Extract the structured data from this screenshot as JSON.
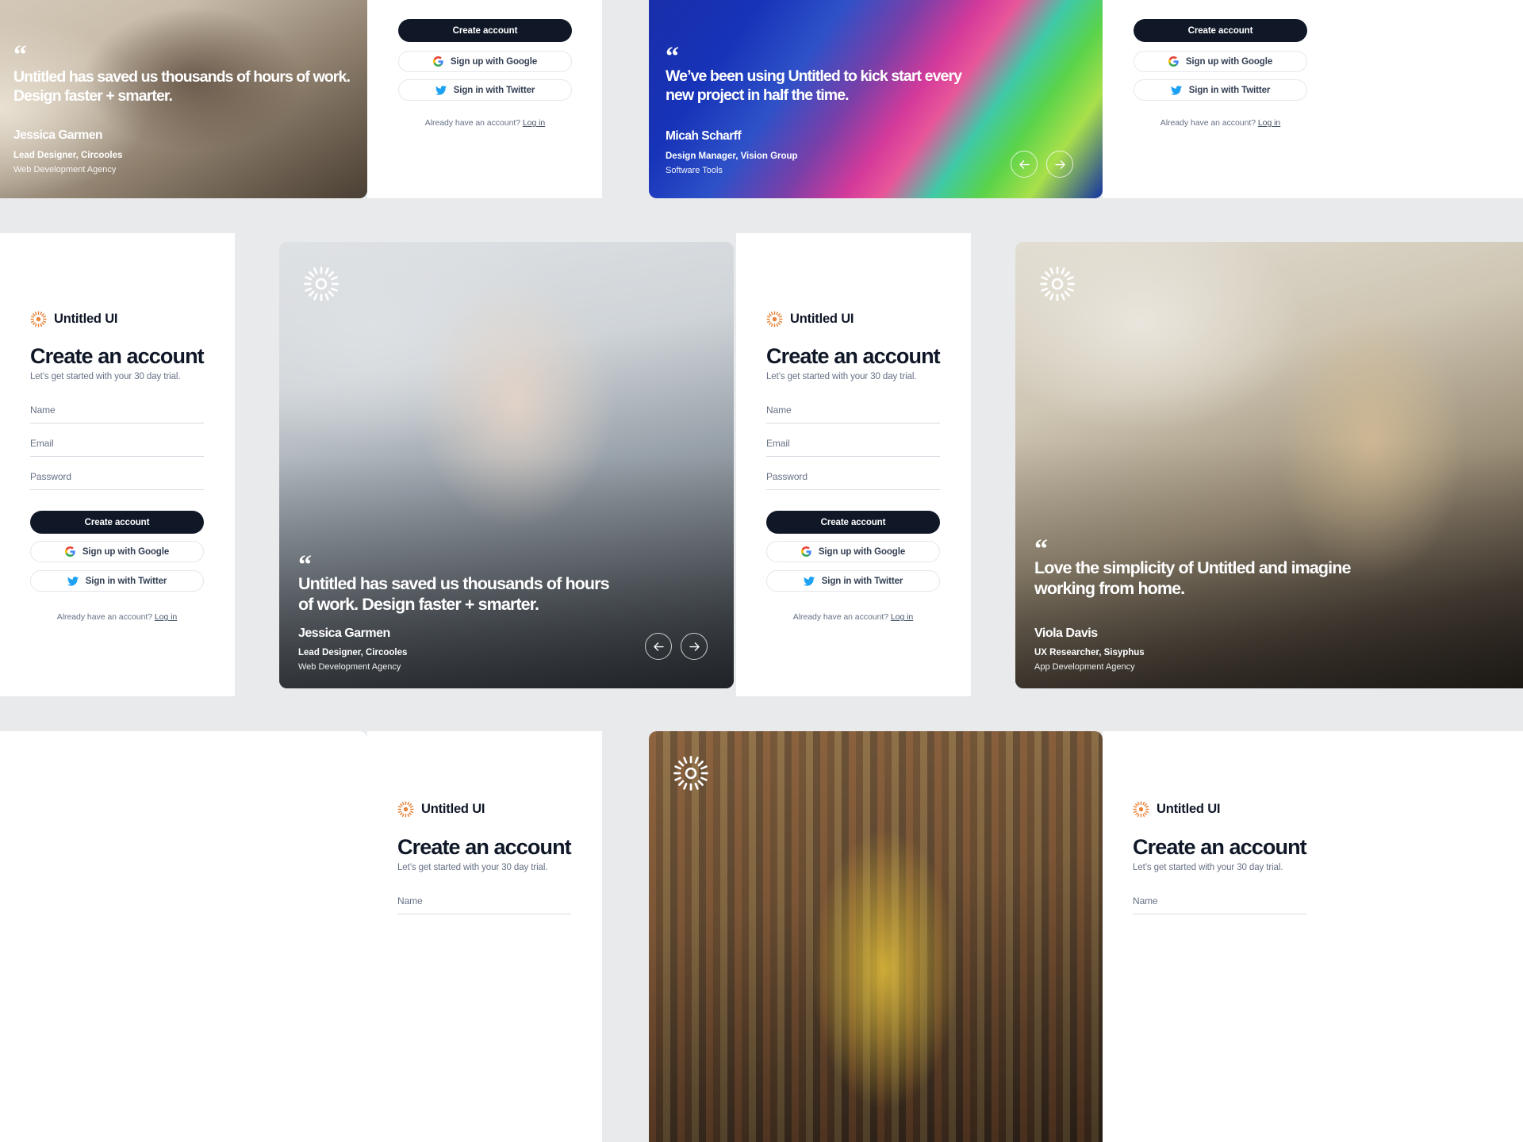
{
  "brand": {
    "name": "Untitled UI",
    "logo_icon": "sun-burst-logo-icon",
    "accent_color": "#E8833A"
  },
  "signup": {
    "title": "Create an account",
    "subtitle": "Let’s get started with your 30 day trial.",
    "fields": [
      {
        "label": "Name",
        "value": "",
        "name": "name-field"
      },
      {
        "label": "Email",
        "value": "",
        "name": "email-field"
      },
      {
        "label": "Password",
        "value": "",
        "name": "password-field"
      }
    ],
    "primary_button": "Create account",
    "google_button": "Sign up with Google",
    "twitter_button": "Sign in with Twitter",
    "footnote_text": "Already have an account?",
    "footnote_link": "Log in"
  },
  "testimonials": {
    "jessica": {
      "quote": "Untitled has saved us thousands of hours of work. Design faster + smarter.",
      "name": "Jessica Garmen",
      "role": "Lead Designer, Circooles",
      "company": "Web Development Agency"
    },
    "micah": {
      "quote": "We’ve been using Untitled to kick start every new project in half the time.",
      "name": "Micah Scharff",
      "role": "Design Manager, Vision Group",
      "company": "Software Tools"
    },
    "viola": {
      "quote": "Love the simplicity of Untitled and imagine working from home.",
      "name": "Viola Davis",
      "role": "UX Researcher, Sisyphus",
      "company": "App Development Agency"
    }
  },
  "carousel": {
    "prev_icon": "arrow-left-icon",
    "next_icon": "arrow-right-icon"
  },
  "colors": {
    "page_background": "#E8EAEC",
    "card_background": "#FFFFFF",
    "primary_button": "#101828",
    "text_primary": "#101828",
    "text_secondary": "#667085",
    "field_underline": "#D7DCE3",
    "rainbow_card": "#1A2EA8"
  }
}
